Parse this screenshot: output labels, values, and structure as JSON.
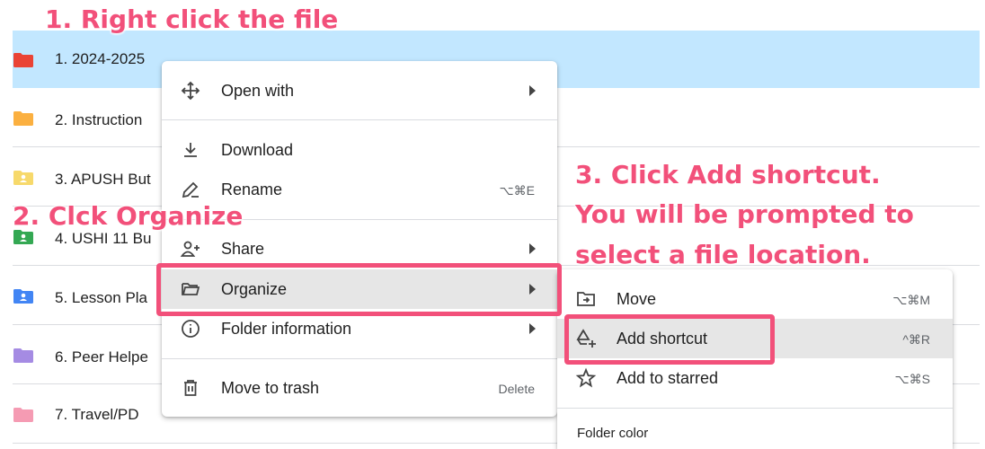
{
  "annotations": {
    "step1": "1. Right click the file",
    "step2": "2. Clck Organize",
    "step3_line1": "3. Click Add shortcut.",
    "step3_line2": "You will be prompted to",
    "step3_line3": "select a file location.",
    "color": "#f2507a"
  },
  "files": [
    {
      "name": "1. 2024-2025",
      "color": "#ea4335",
      "icon": "folder-icon"
    },
    {
      "name": "2. Instruction",
      "color": "#fbb040",
      "icon": "folder-icon"
    },
    {
      "name": "3. APUSH But",
      "color": "#f7d96b",
      "icon": "shared-folder-icon"
    },
    {
      "name": "4. USHI 11 Bu",
      "color": "#34a853",
      "icon": "shared-folder-icon"
    },
    {
      "name": "5. Lesson Pla",
      "color": "#4285f4",
      "icon": "shared-folder-icon"
    },
    {
      "name": "6. Peer Helpe",
      "color": "#a58be3",
      "icon": "folder-icon"
    },
    {
      "name": "7. Travel/PD",
      "color": "#f59bb3",
      "icon": "folder-icon"
    }
  ],
  "context_menu": {
    "items": [
      {
        "label": "Open with",
        "icon": "move-arrows-icon",
        "submenu": true
      },
      {
        "label": "Download",
        "icon": "download-icon"
      },
      {
        "label": "Rename",
        "icon": "pencil-icon",
        "shortcut": "⌥⌘E"
      },
      {
        "label": "Share",
        "icon": "add-person-icon",
        "submenu": true
      },
      {
        "label": "Organize",
        "icon": "folder-open-icon",
        "submenu": true,
        "highlighted": true
      },
      {
        "label": "Folder information",
        "icon": "info-icon",
        "submenu": true
      },
      {
        "label": "Move to trash",
        "icon": "trash-icon",
        "shortcut": "Delete"
      }
    ]
  },
  "organize_submenu": {
    "items": [
      {
        "label": "Move",
        "icon": "move-to-folder-icon",
        "shortcut": "⌥⌘M"
      },
      {
        "label": "Add shortcut",
        "icon": "add-shortcut-icon",
        "shortcut": "^⌘R",
        "highlighted": true
      },
      {
        "label": "Add to starred",
        "icon": "star-icon",
        "shortcut": "⌥⌘S"
      }
    ],
    "section_label": "Folder color"
  }
}
